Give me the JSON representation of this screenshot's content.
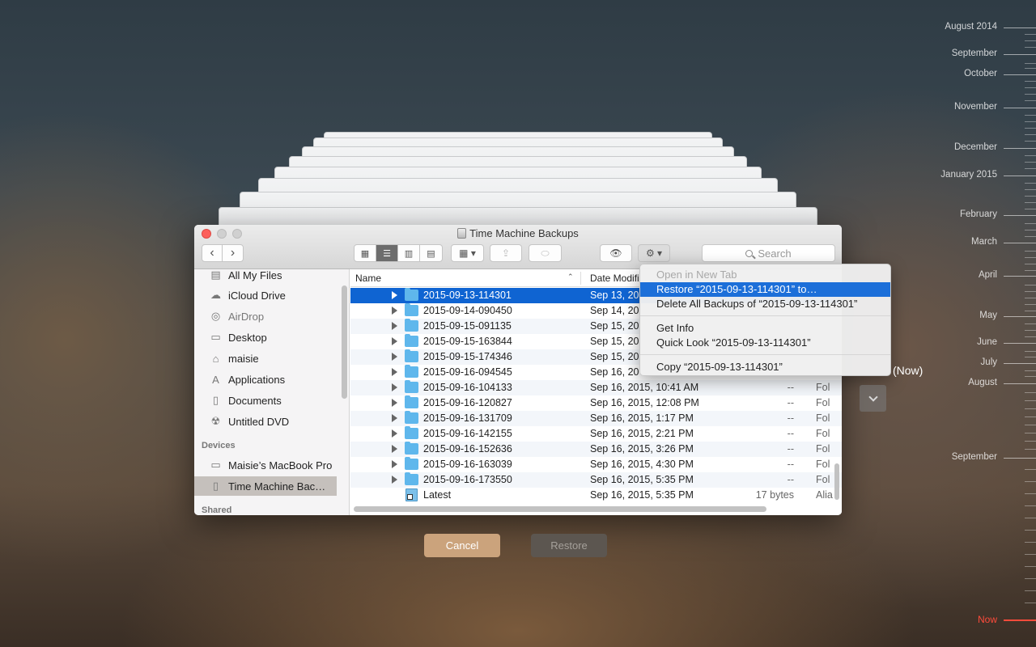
{
  "window": {
    "title": "Time Machine Backups",
    "search_placeholder": "Search"
  },
  "sidebar": {
    "items": [
      {
        "label": "All My Files",
        "icon": "all-files-icon"
      },
      {
        "label": "iCloud Drive",
        "icon": "cloud-icon"
      },
      {
        "label": "AirDrop",
        "icon": "airdrop-icon"
      },
      {
        "label": "Desktop",
        "icon": "desktop-icon"
      },
      {
        "label": "maisie",
        "icon": "home-icon"
      },
      {
        "label": "Applications",
        "icon": "applications-icon"
      },
      {
        "label": "Documents",
        "icon": "documents-icon"
      },
      {
        "label": "Untitled DVD",
        "icon": "dvd-icon"
      }
    ],
    "devices_header": "Devices",
    "devices": [
      {
        "label": "Maisie’s MacBook Pro",
        "icon": "laptop-icon"
      },
      {
        "label": "Time Machine Bac…",
        "icon": "drive-icon"
      }
    ],
    "shared_header": "Shared"
  },
  "list": {
    "columns": {
      "name": "Name",
      "date": "Date Modifi"
    },
    "rows": [
      {
        "name": "2015-09-13-114301",
        "date": "Sep 13, 20",
        "size": "",
        "kind": ""
      },
      {
        "name": "2015-09-14-090450",
        "date": "Sep 14, 20",
        "size": "",
        "kind": ""
      },
      {
        "name": "2015-09-15-091135",
        "date": "Sep 15, 20",
        "size": "",
        "kind": ""
      },
      {
        "name": "2015-09-15-163844",
        "date": "Sep 15, 20",
        "size": "",
        "kind": ""
      },
      {
        "name": "2015-09-15-174346",
        "date": "Sep 15, 20",
        "size": "",
        "kind": ""
      },
      {
        "name": "2015-09-16-094545",
        "date": "Sep 16, 20",
        "size": "",
        "kind": ""
      },
      {
        "name": "2015-09-16-104133",
        "date": "Sep 16, 2015, 10:41 AM",
        "size": "--",
        "kind": "Fol"
      },
      {
        "name": "2015-09-16-120827",
        "date": "Sep 16, 2015, 12:08 PM",
        "size": "--",
        "kind": "Fol"
      },
      {
        "name": "2015-09-16-131709",
        "date": "Sep 16, 2015, 1:17 PM",
        "size": "--",
        "kind": "Fol"
      },
      {
        "name": "2015-09-16-142155",
        "date": "Sep 16, 2015, 2:21 PM",
        "size": "--",
        "kind": "Fol"
      },
      {
        "name": "2015-09-16-152636",
        "date": "Sep 16, 2015, 3:26 PM",
        "size": "--",
        "kind": "Fol"
      },
      {
        "name": "2015-09-16-163039",
        "date": "Sep 16, 2015, 4:30 PM",
        "size": "--",
        "kind": "Fol"
      },
      {
        "name": "2015-09-16-173550",
        "date": "Sep 16, 2015, 5:35 PM",
        "size": "--",
        "kind": "Fol"
      },
      {
        "name": "Latest",
        "date": "Sep 16, 2015, 5:35 PM",
        "size": "17 bytes",
        "kind": "Alia"
      }
    ]
  },
  "context_menu": {
    "open_new_tab": "Open in New Tab",
    "restore": "Restore “2015-09-13-114301” to…",
    "delete_all": "Delete All Backups of “2015-09-13-114301”",
    "get_info": "Get Info",
    "quick_look": "Quick Look “2015-09-13-114301”",
    "copy": "Copy “2015-09-13-114301”"
  },
  "buttons": {
    "cancel": "Cancel",
    "restore": "Restore"
  },
  "now_label": "(Now)",
  "timeline": {
    "labels": [
      "August 2014",
      "September",
      "October",
      "November",
      "December",
      "January 2015",
      "February",
      "March",
      "April",
      "May",
      "June",
      "July",
      "August",
      "September"
    ],
    "now": "Now"
  },
  "colors": {
    "selection": "#0f64d2",
    "menu_highlight": "#1c6fd9",
    "now": "#ff4b3b",
    "cancel": "#cba37c"
  }
}
